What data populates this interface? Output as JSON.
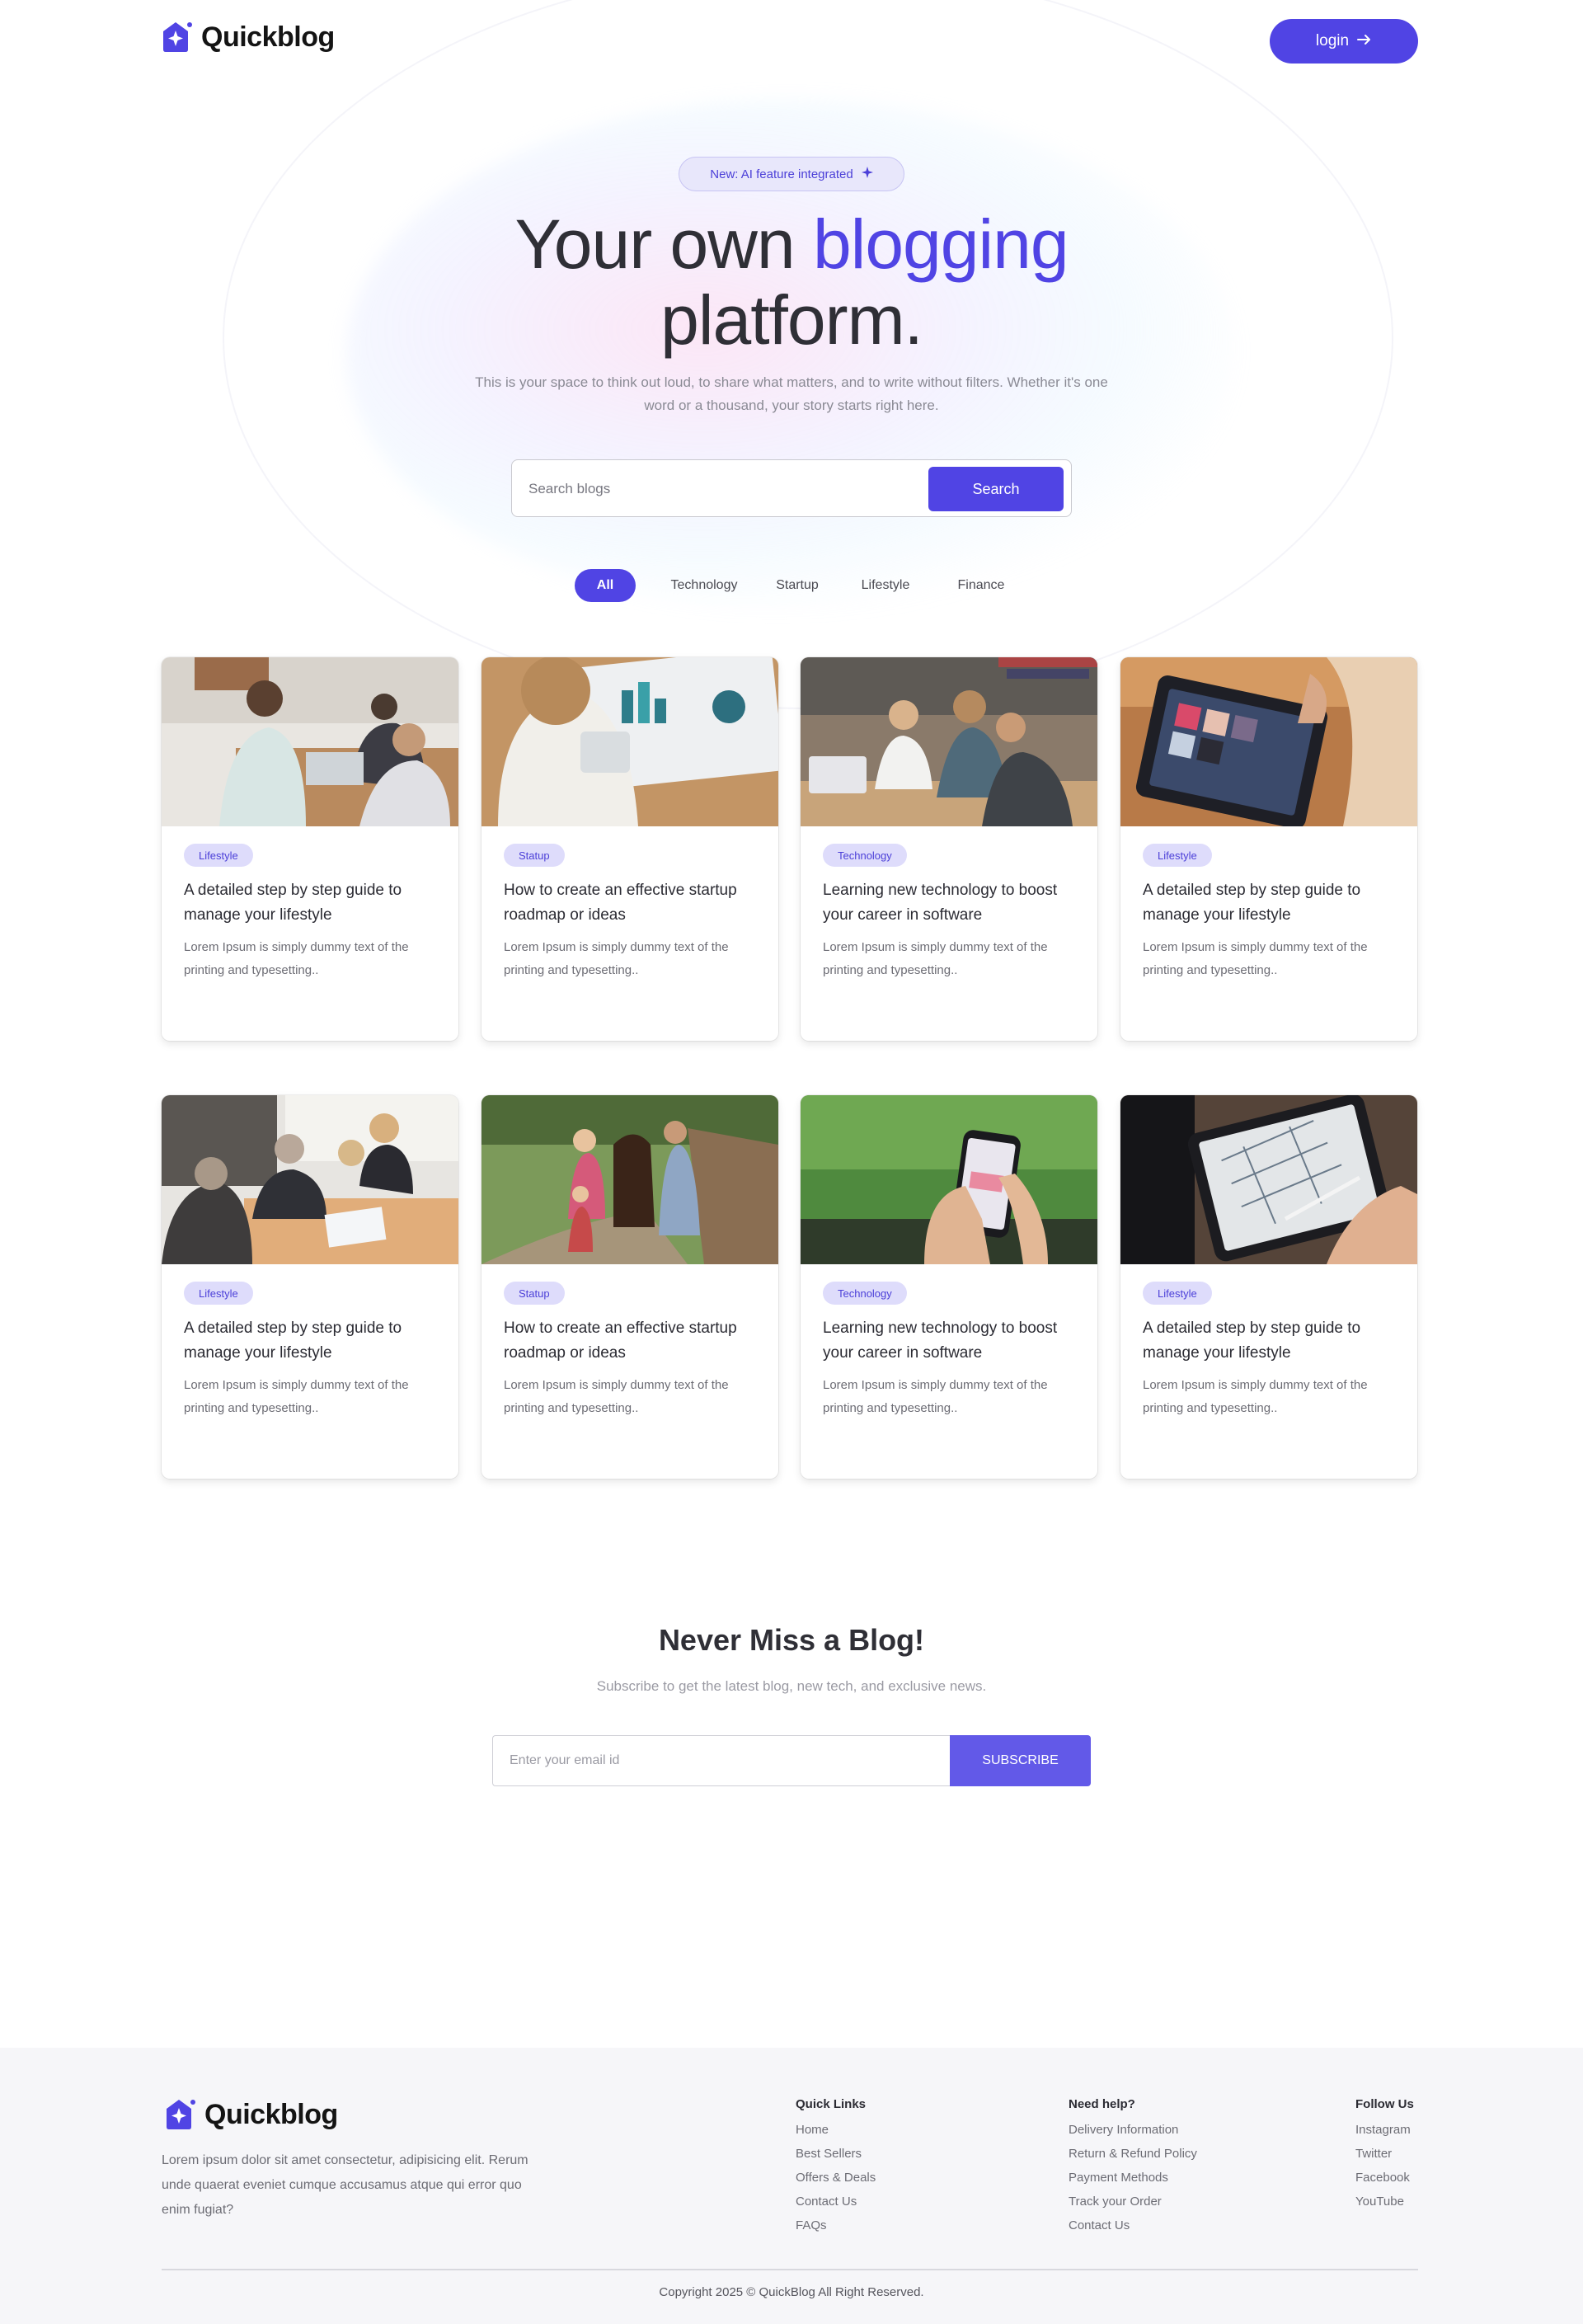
{
  "brand": {
    "name": "Quickblog",
    "accent_color": "#5044e4"
  },
  "header": {
    "login_label": "login",
    "login_icon": "arrow-right-icon"
  },
  "hero": {
    "badge_text": "New: AI feature integrated",
    "badge_icon": "star-icon",
    "title_part1": "Your own",
    "title_accent": "blogging",
    "title_part2": "platform.",
    "subtitle": "This is your space to think out loud, to share what matters, and to write without filters. Whether it's one word or a thousand, your story starts right here."
  },
  "search": {
    "placeholder": "Search blogs",
    "button_label": "Search"
  },
  "filters": {
    "items": [
      "All",
      "Technology",
      "Startup",
      "Lifestyle",
      "Finance"
    ],
    "active": "All"
  },
  "posts": [
    {
      "tag": "Lifestyle",
      "title": "A detailed step by step guide to manage your lifestyle",
      "excerpt": "Lorem Ipsum is simply dummy text of the printing and typesetting.."
    },
    {
      "tag": "Statup",
      "title": "How to create an effective startup roadmap or ideas",
      "excerpt": "Lorem Ipsum is simply dummy text of the printing and typesetting.."
    },
    {
      "tag": "Technology",
      "title": "Learning new technology to boost your career in software",
      "excerpt": "Lorem Ipsum is simply dummy text of the printing and typesetting.."
    },
    {
      "tag": "Lifestyle",
      "title": "A detailed step by step guide to manage your lifestyle",
      "excerpt": "Lorem Ipsum is simply dummy text of the printing and typesetting.."
    },
    {
      "tag": "Lifestyle",
      "title": "A detailed step by step guide to manage your lifestyle",
      "excerpt": "Lorem Ipsum is simply dummy text of the printing and typesetting.."
    },
    {
      "tag": "Statup",
      "title": "How to create an effective startup roadmap or ideas",
      "excerpt": "Lorem Ipsum is simply dummy text of the printing and typesetting.."
    },
    {
      "tag": "Technology",
      "title": "Learning new technology to boost your career in software",
      "excerpt": "Lorem Ipsum is simply dummy text of the printing and typesetting.."
    },
    {
      "tag": "Lifestyle",
      "title": "A detailed step by step guide to manage your lifestyle",
      "excerpt": "Lorem Ipsum is simply dummy text of the printing and typesetting.."
    }
  ],
  "newsletter": {
    "title": "Never Miss a Blog!",
    "subtitle": "Subscribe to get the latest blog, new tech, and exclusive news.",
    "placeholder": "Enter your email id",
    "button_label": "SUBSCRIBE"
  },
  "footer": {
    "description": "Lorem ipsum dolor sit amet consectetur, adipisicing elit. Rerum unde quaerat eveniet cumque accusamus atque qui error quo enim fugiat?",
    "columns": [
      {
        "heading": "Quick Links",
        "links": [
          "Home",
          "Best Sellers",
          "Offers & Deals",
          "Contact Us",
          "FAQs"
        ]
      },
      {
        "heading": "Need help?",
        "links": [
          "Delivery Information",
          "Return & Refund Policy",
          "Payment Methods",
          "Track your Order",
          "Contact Us"
        ]
      },
      {
        "heading": "Follow Us",
        "links": [
          "Instagram",
          "Twitter",
          "Facebook",
          "YouTube"
        ]
      }
    ],
    "copyright": "Copyright 2025 © QuickBlog All Right Reserved."
  }
}
